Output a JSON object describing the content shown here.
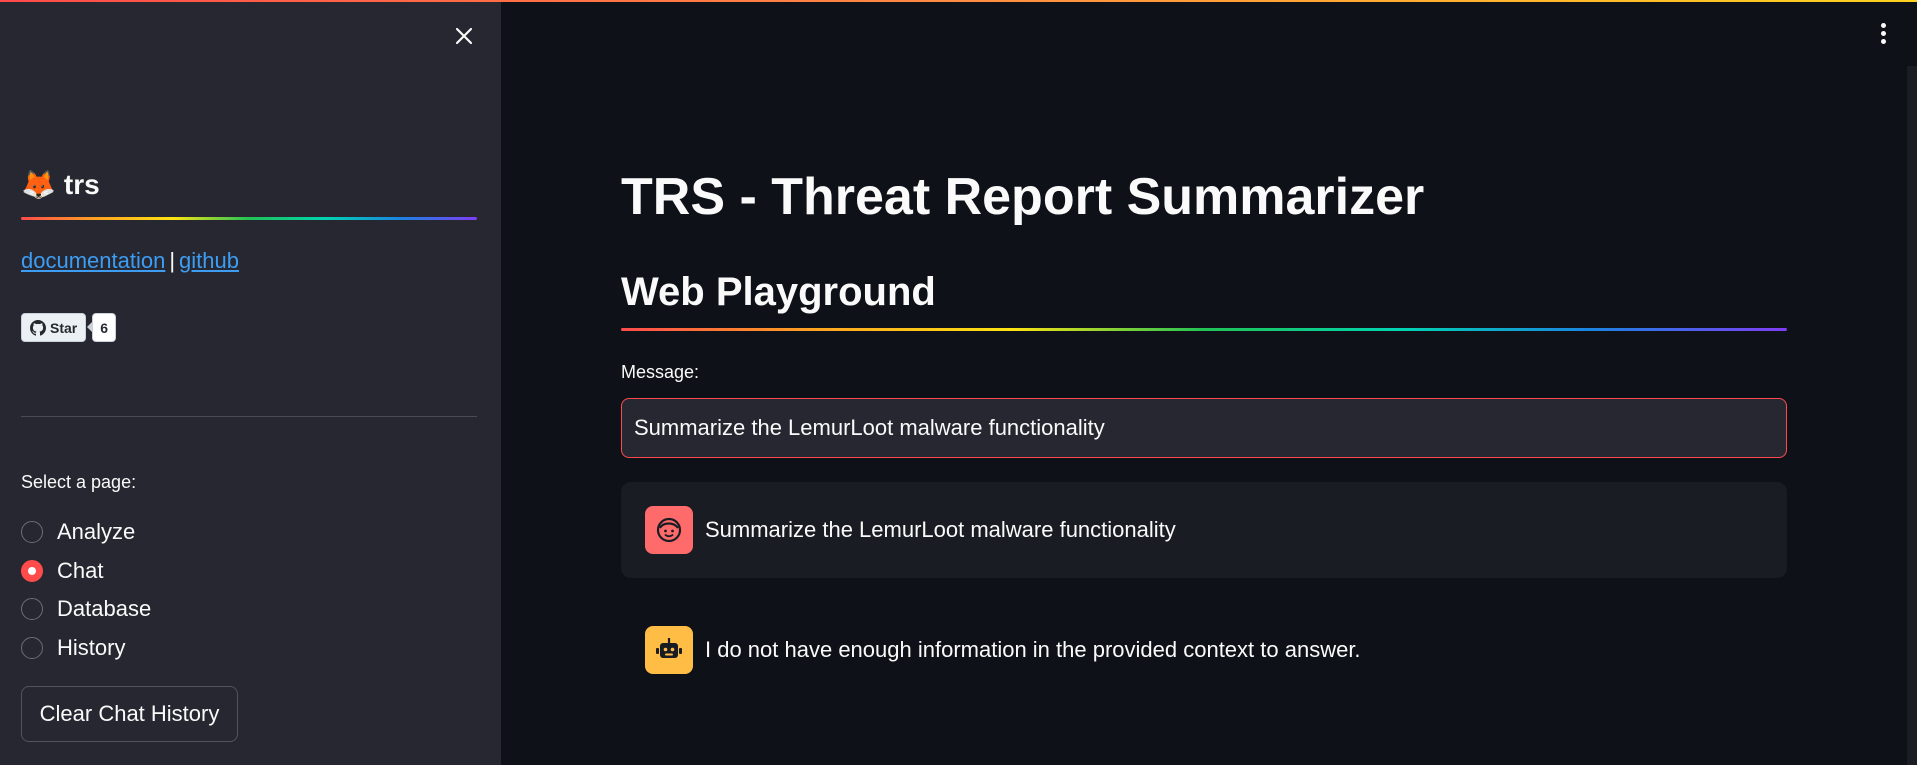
{
  "sidebar": {
    "brand_emoji": "🦊",
    "brand_name": "trs",
    "links": {
      "documentation": "documentation",
      "separator": "|",
      "github": "github"
    },
    "github_badge": {
      "label": "Star",
      "count": "6"
    },
    "select_label": "Select a page:",
    "pages": [
      {
        "label": "Analyze",
        "selected": false
      },
      {
        "label": "Chat",
        "selected": true
      },
      {
        "label": "Database",
        "selected": false
      },
      {
        "label": "History",
        "selected": false
      }
    ],
    "clear_button": "Clear Chat History"
  },
  "main": {
    "title": "TRS - Threat Report Summarizer",
    "subtitle": "Web Playground",
    "message_label": "Message:",
    "message_value": "Summarize the LemurLoot malware functionality",
    "messages": [
      {
        "role": "user",
        "avatar_icon": "user-face-icon",
        "text": "Summarize the LemurLoot malware functionality"
      },
      {
        "role": "assistant",
        "avatar_icon": "robot-icon",
        "text": "I do not have enough information in the provided context to answer."
      }
    ]
  },
  "colors": {
    "accent": "#ff4b4b",
    "link": "#3d9df3",
    "sidebar_bg": "#262730",
    "main_bg": "#0e1117",
    "user_avatar": "#ff6b6b",
    "bot_avatar": "#ffbd45"
  }
}
